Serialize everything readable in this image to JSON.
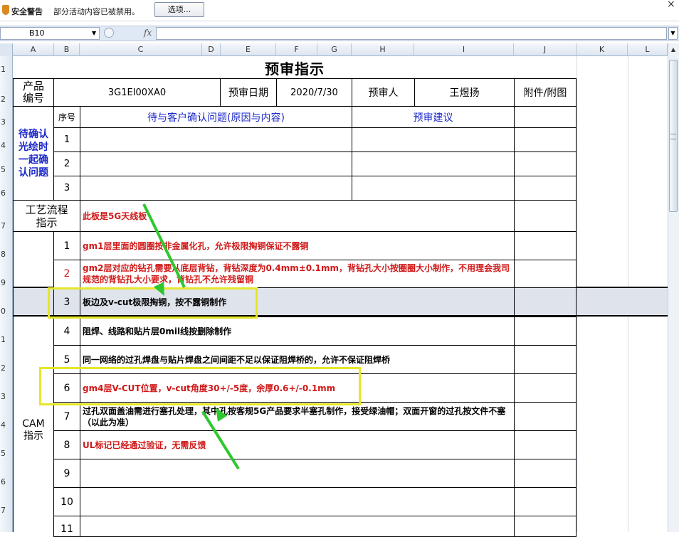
{
  "security_bar": {
    "title": "安全警告",
    "message": "部分活动内容已被禁用。",
    "options_button": "选项...",
    "close": "×"
  },
  "formula_bar": {
    "name_box": "B10",
    "fx": "fx",
    "formula": ""
  },
  "columns": [
    "A",
    "B",
    "C",
    "D",
    "E",
    "F",
    "G",
    "H",
    "I",
    "J",
    "K",
    "L"
  ],
  "rows": [
    "1",
    "2",
    "3",
    "4",
    "5",
    "6",
    "7",
    "8",
    "9",
    "0",
    "1",
    "2",
    "3",
    "4",
    "5",
    "6",
    "7"
  ],
  "sheet": {
    "title": "预审指示",
    "product_label": "产品\n编号",
    "product_code": "3G1EI00XA0",
    "review_date_label": "预审日期",
    "review_date": "2020/7/30",
    "reviewer_label": "预审人",
    "reviewer": "王煜扬",
    "attachment_label": "附件/附图",
    "seq_label": "序号",
    "issues_label": "待与客户确认问题(原因与内容)",
    "suggestion_label": "预审建议",
    "confirm_section_label": "待确认\n光绘时\n一起确\n认问题",
    "confirm_items": [
      "1",
      "2",
      "3"
    ],
    "process_label": "工艺流程\n指示",
    "process_text": "此板是5G天线板",
    "cam_label": "CAM\n指示",
    "cam_items": [
      {
        "no": "1",
        "text": "gm1层里面的圆圈按非金属化孔，允许极限掏铜保证不露铜",
        "color": "red"
      },
      {
        "no": "2",
        "text": "gm2层对应的钻孔需要从底层背钻，背钻深度为0.4mm±0.1mm，背钻孔大小按圈圈大小制作，不用理会我司规范的背钻孔大小要求，背钻孔不允许残留铜",
        "color": "red"
      },
      {
        "no": "3",
        "text": "板边及v-cut极限掏铜，按不露铜制作",
        "color": "black"
      },
      {
        "no": "4",
        "text": "阻焊、线路和贴片层0mil线按删除制作",
        "color": "black"
      },
      {
        "no": "5",
        "text": "同一网络的过孔焊盘与贴片焊盘之间间距不足以保证阻焊桥的，允许不保证阻焊桥",
        "color": "black"
      },
      {
        "no": "6",
        "text": "gm4层V-CUT位置，v-cut角度30+/-5度，余厚0.6+/-0.1mm",
        "color": "red"
      },
      {
        "no": "7",
        "text": "过孔双面盖油需进行塞孔处理，其中孔按客规5G产品要求半塞孔制作，接受绿油帽；双面开窗的过孔按文件不塞（以此为准）",
        "color": "black"
      },
      {
        "no": "8",
        "text": "UL标记已经通过验证，无需反馈",
        "color": "red"
      },
      {
        "no": "9",
        "text": "",
        "color": "black"
      },
      {
        "no": "10",
        "text": "",
        "color": "black"
      },
      {
        "no": "11",
        "text": "",
        "color": "black"
      }
    ]
  },
  "colors": {
    "accent_blue": "#1b28c8",
    "text_red": "#d01818",
    "highlight_yellow": "#e6e62a",
    "arrow_green": "#2ec82e"
  }
}
